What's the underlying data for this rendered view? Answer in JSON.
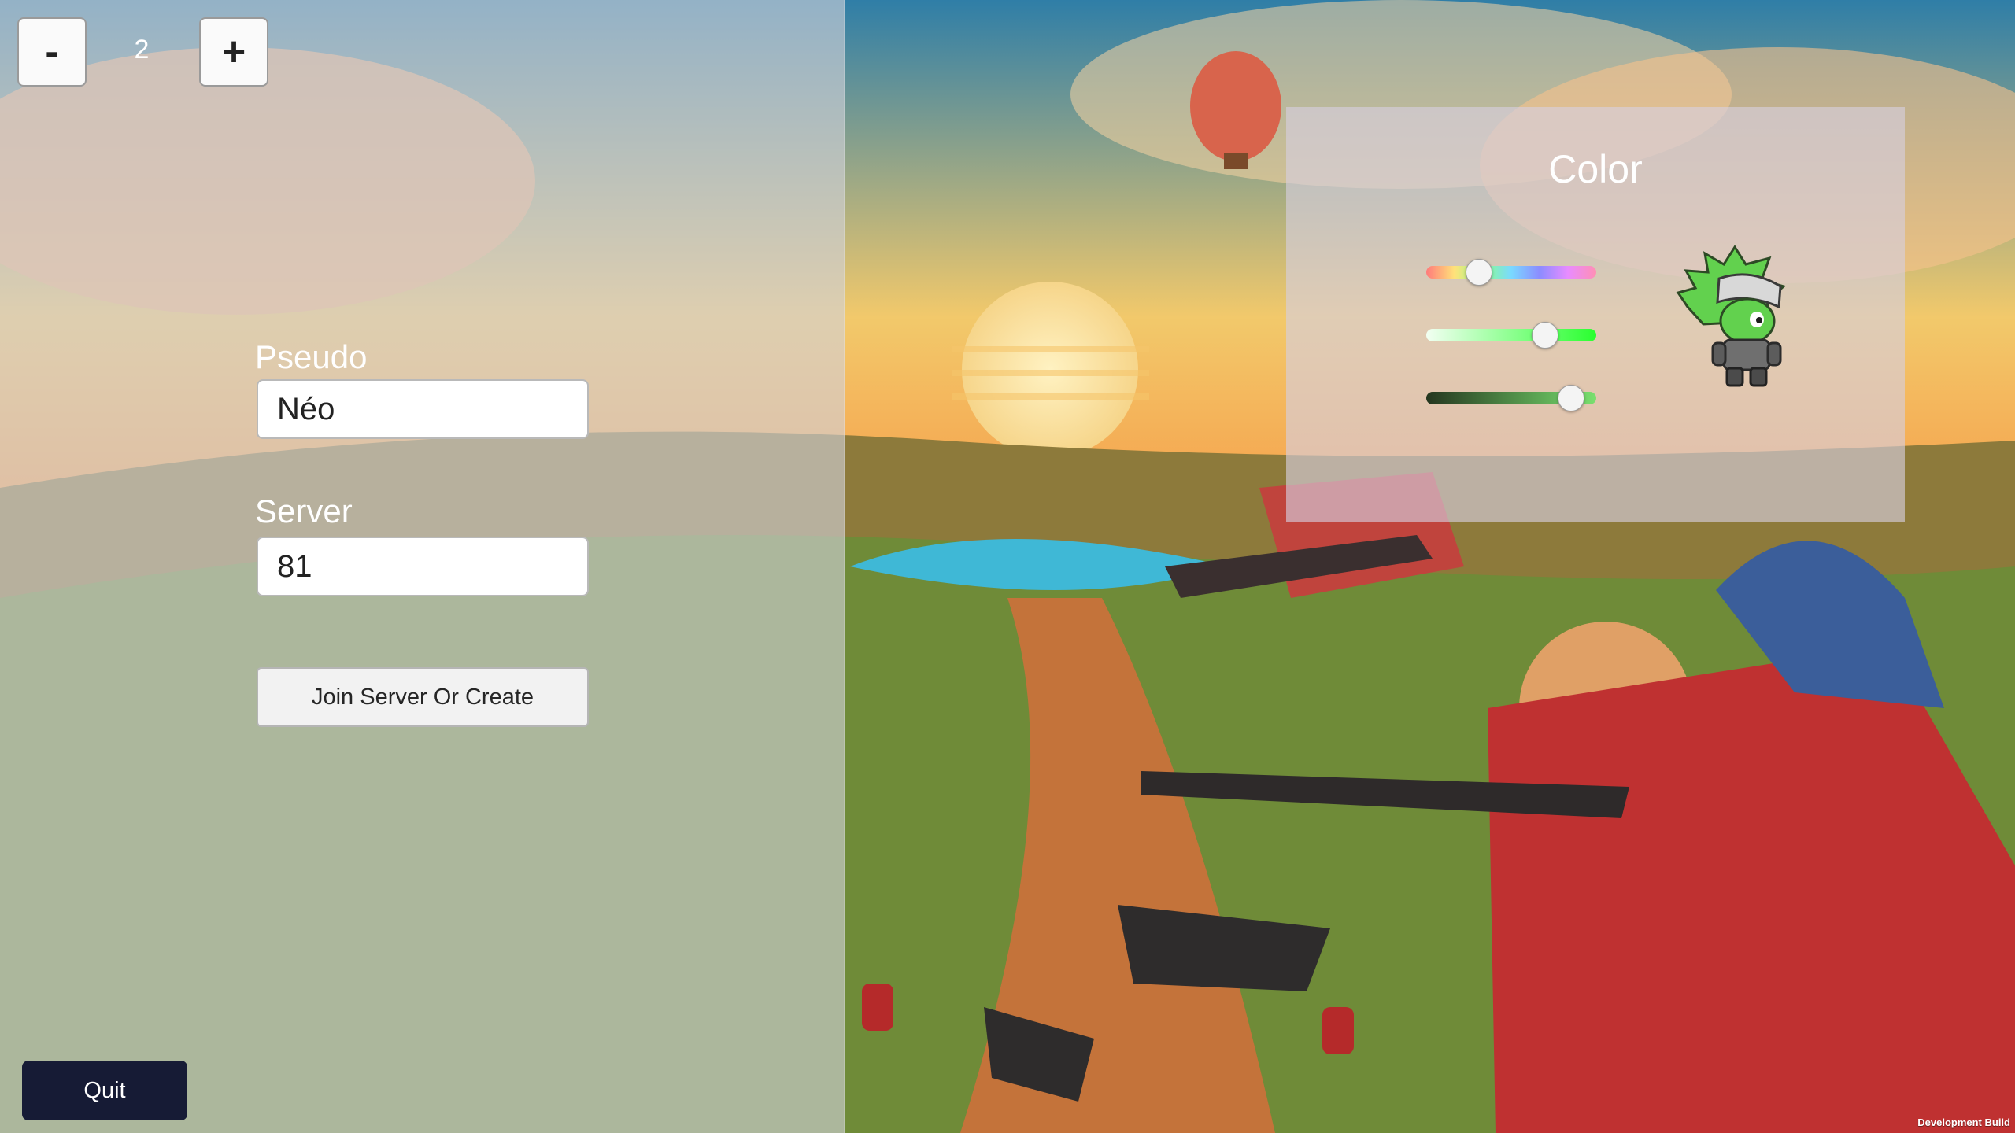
{
  "stepper": {
    "minus_label": "-",
    "plus_label": "+",
    "value": "2"
  },
  "form": {
    "pseudo_label": "Pseudo",
    "pseudo_value": "Néo",
    "server_label": "Server",
    "server_value": "81",
    "join_label": "Join Server Or Create"
  },
  "quit_label": "Quit",
  "color_panel": {
    "title": "Color",
    "sliders": [
      {
        "name": "hue",
        "value": 0.31
      },
      {
        "name": "saturation",
        "value": 0.7
      },
      {
        "name": "value",
        "value": 0.85
      }
    ],
    "character_color": "#62d14e"
  },
  "footer": {
    "build_label": "Development Build"
  },
  "colors": {
    "quit_button": "#161b35",
    "panel_overlay": "#d2d2da"
  }
}
